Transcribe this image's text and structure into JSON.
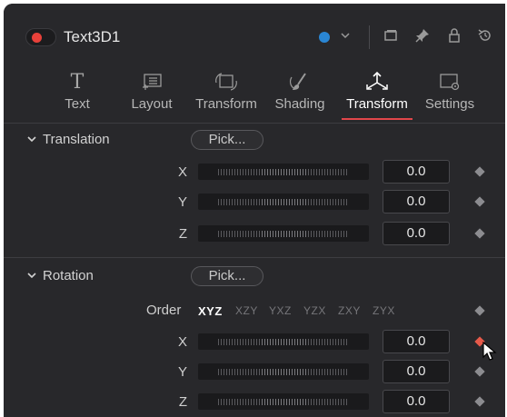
{
  "header": {
    "tool_name": "Text3D1",
    "enabled_color": "#e8413a",
    "node_color": "#2a86d4",
    "icons": [
      "color-dropdown-chevron-icon",
      "window-icon",
      "pin-icon",
      "lock-icon",
      "reset-icon"
    ]
  },
  "tabs": [
    {
      "label": "Text",
      "icon": "text-icon"
    },
    {
      "label": "Layout",
      "icon": "layout-icon"
    },
    {
      "label": "Transform",
      "icon": "transform-icon"
    },
    {
      "label": "Shading",
      "icon": "shading-icon"
    },
    {
      "label": "Transform",
      "icon": "3d-transform-icon",
      "active": true
    },
    {
      "label": "Settings",
      "icon": "settings-icon"
    }
  ],
  "translation": {
    "title": "Translation",
    "pick_label": "Pick...",
    "rows": [
      {
        "axis": "X",
        "value": "0.0"
      },
      {
        "axis": "Y",
        "value": "0.0"
      },
      {
        "axis": "Z",
        "value": "0.0"
      }
    ]
  },
  "rotation": {
    "title": "Rotation",
    "pick_label": "Pick...",
    "order_label": "Order",
    "order_options": [
      "XYZ",
      "XZY",
      "YXZ",
      "YZX",
      "ZXY",
      "ZYX"
    ],
    "order_selected": "XYZ",
    "rows": [
      {
        "axis": "X",
        "value": "0.0"
      },
      {
        "axis": "Y",
        "value": "0.0"
      },
      {
        "axis": "Z",
        "value": "0.0"
      }
    ]
  },
  "accent_color": "#e0464a"
}
